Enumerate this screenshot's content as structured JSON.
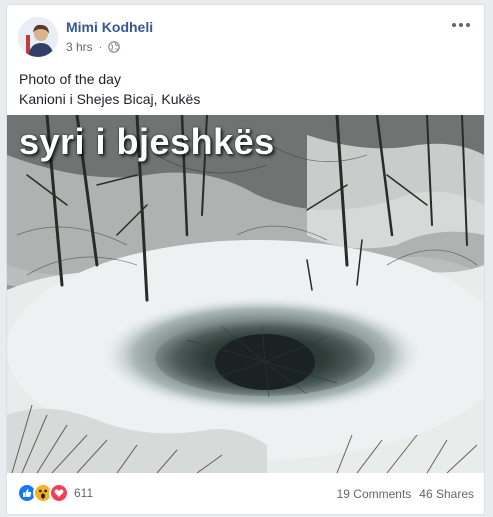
{
  "post": {
    "author": "Mimi Kodheli",
    "time": "3 hrs",
    "privacy_icon": "globe-icon",
    "more_icon": "more-options-icon",
    "text_lines": [
      "Photo of the day",
      "Kanioni i Shejes Bicaj, Kukës"
    ],
    "photo_overlay_text": "syri i bjeshkës"
  },
  "footer": {
    "reactions": [
      {
        "name": "like",
        "icon": "like-icon",
        "color": "#1877f2"
      },
      {
        "name": "wow",
        "icon": "wow-icon",
        "color": "#f7b125"
      },
      {
        "name": "love",
        "icon": "love-icon",
        "color": "#f33e58"
      }
    ],
    "reaction_count": "611",
    "comments": "19 Comments",
    "shares": "46 Shares"
  },
  "colors": {
    "author_link": "#365899",
    "meta_text": "#616770",
    "body_text": "#1d2129",
    "card_border": "#dddfe2",
    "page_bg": "#e9ebee"
  }
}
